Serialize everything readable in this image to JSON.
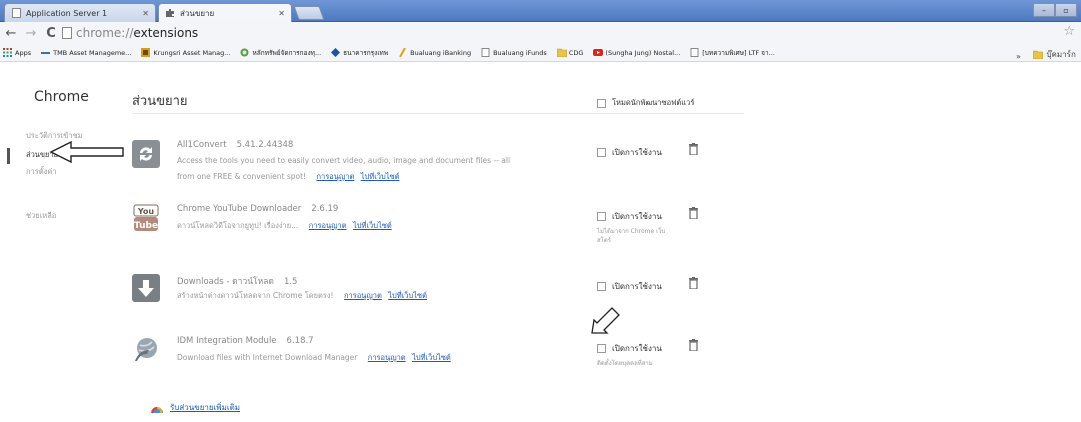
{
  "tabs": [
    {
      "title": "Application Server 1",
      "active": false
    },
    {
      "title": "ส่วนขยาย",
      "active": true
    }
  ],
  "window_controls": {
    "minimize": "–",
    "restore": "▫"
  },
  "omnibox": {
    "scheme": "chrome://",
    "host": "extensions"
  },
  "bookmarks": [
    {
      "label": "Apps",
      "icon": "apps-grid-icon"
    },
    {
      "label": "TMB Asset Manageme...",
      "icon": "tmb-icon"
    },
    {
      "label": "Krungsri Asset Manag...",
      "icon": "krungsri-icon"
    },
    {
      "label": "หลักทรัพย์จัดการกองทุ...",
      "icon": "globe-icon"
    },
    {
      "label": "ธนาคารกรุงเทพ",
      "icon": "bbl-icon"
    },
    {
      "label": "Bualuang iBanking",
      "icon": "feather-icon"
    },
    {
      "label": "Bualuang iFunds",
      "icon": "page-icon"
    },
    {
      "label": "CDG",
      "icon": "folder-icon"
    },
    {
      "label": "(Sungha Jung) Nostal...",
      "icon": "youtube-icon"
    },
    {
      "label": "[บทความพิเศษ] LTF จา...",
      "icon": "page-icon"
    }
  ],
  "bookmarks_overflow": "»",
  "bookmarks_other": "บุ๊คมาร์ก",
  "sidebar": {
    "title": "Chrome",
    "items": [
      {
        "label": "ประวัติการเข้าชม",
        "selected": false
      },
      {
        "label": "ส่วนขยาย",
        "selected": true
      },
      {
        "label": "การตั้งค่า",
        "selected": false
      },
      {
        "label": "ช่วยเหลือ",
        "selected": false
      }
    ]
  },
  "header": {
    "title": "ส่วนขยาย",
    "developer_mode_label": "โหมดนักพัฒนาซอฟต์แวร์"
  },
  "extensions": [
    {
      "name": "All1Convert",
      "version": "5.41.2.44348",
      "description": "Access the tools you need to easily convert video, audio, image and document files -- all",
      "description2": "from one FREE & convenient spot!",
      "permissions_link": "การอนุญาต",
      "website_link": "ไปที่เว็บไซต์",
      "enable_label": "เปิดการใช้งาน",
      "note": "",
      "icon": "convert-icon",
      "icon_color": "#8a8f96"
    },
    {
      "name": "Chrome YouTube Downloader",
      "version": "2.6.19",
      "description": "ดาวน์โหลดวิดีโอจากยูทูป! เรื่องง่าย...",
      "description2": "",
      "permissions_link": "การอนุญาต",
      "website_link": "ไปที่เว็บไซต์",
      "enable_label": "เปิดการใช้งาน",
      "note": "ไม่ได้มาจาก Chrome เว็บสโตร์",
      "icon": "youtube-tube-icon",
      "icon_color": "#b48a7c"
    },
    {
      "name": "Downloads - ดาวน์โหลด",
      "version": "1.5",
      "description": "สร้างหน้าต่างดาวน์โหลดจาก Chrome โดยตรง!",
      "description2": "",
      "permissions_link": "การอนุญาต",
      "website_link": "ไปที่เว็บไซต์",
      "enable_label": "เปิดการใช้งาน",
      "note": "",
      "icon": "download-arrow-icon",
      "icon_color": "#7a7f86"
    },
    {
      "name": "IDM Integration Module",
      "version": "6.18.7",
      "description": "Download files with Internet Download Manager",
      "description2": "",
      "permissions_link": "การอนุญาต",
      "website_link": "ไปที่เว็บไซต์",
      "enable_label": "เปิดการใช้งาน",
      "note": "ติดตั้งโดยบุคคลที่สาม",
      "icon": "idm-globe-icon",
      "icon_color": "#7f8a96"
    }
  ],
  "get_more_label": "รับส่วนขยายเพิ่มเติม",
  "colors": {
    "link": "#1a5bbd",
    "tabstrip": "#5b84c8"
  }
}
